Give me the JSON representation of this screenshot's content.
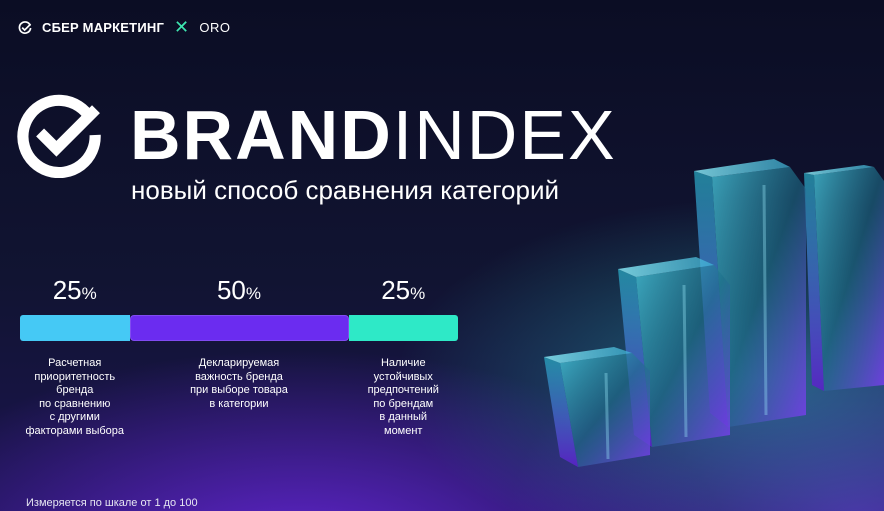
{
  "header": {
    "sber_label": "СБЕР МАРКЕТИНГ",
    "separator": "✕",
    "partner_label": "ORO"
  },
  "brand": {
    "title_bold": "BRAND",
    "title_light": "INDEX",
    "subtitle": "новый способ сравнения категорий"
  },
  "breakdown": {
    "segments": [
      {
        "percent": "25",
        "unit": "%",
        "share": 0.25,
        "color": "#45c9f5",
        "description": "Расчетная\nприоритетность\nбренда\nпо сравнению\nс другими\nфакторами выбора"
      },
      {
        "percent": "50",
        "unit": "%",
        "share": 0.5,
        "color": "#6b2cf0",
        "description": "Декларируемая\nважность бренда\nпри выборе товара\nв категории"
      },
      {
        "percent": "25",
        "unit": "%",
        "share": 0.25,
        "color": "#2ee9c7",
        "description": "Наличие\nустойчивых\nпредпочтений\nпо брендам\nв данный\nмомент"
      }
    ]
  },
  "footnote": "Измеряется по шкале от 1 до 100",
  "colors": {
    "accent_teal": "#2ee9c7",
    "accent_violet": "#6b2cf0",
    "accent_blue": "#45c9f5"
  },
  "icons": {
    "sber": "check-circle-icon",
    "brand": "check-circle-icon"
  }
}
